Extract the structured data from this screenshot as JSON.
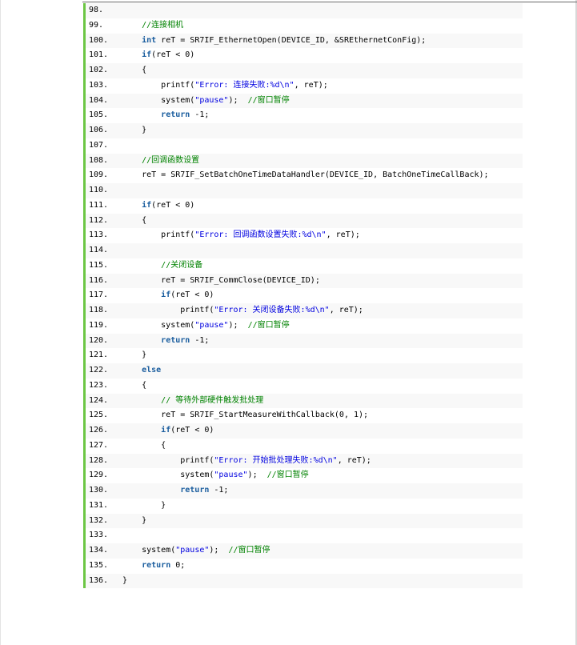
{
  "lines": [
    {
      "num": "98.",
      "parts": []
    },
    {
      "num": "99.",
      "parts": [
        [
          "",
          "    "
        ],
        [
          "cm",
          "//连接相机"
        ]
      ]
    },
    {
      "num": "100.",
      "parts": [
        [
          "",
          "    "
        ],
        [
          "kw",
          "int"
        ],
        [
          "",
          " reT = SR7IF_EthernetOpen(DEVICE_ID, &SREthernetConFig);"
        ]
      ]
    },
    {
      "num": "101.",
      "parts": [
        [
          "",
          "    "
        ],
        [
          "kw",
          "if"
        ],
        [
          "",
          "(reT < 0)"
        ]
      ]
    },
    {
      "num": "102.",
      "parts": [
        [
          "",
          "    {"
        ]
      ]
    },
    {
      "num": "103.",
      "parts": [
        [
          "",
          "        printf("
        ],
        [
          "str",
          "\"Error: 连接失败:%d\\n\""
        ],
        [
          "",
          ", reT);"
        ]
      ]
    },
    {
      "num": "104.",
      "parts": [
        [
          "",
          "        system("
        ],
        [
          "str",
          "\"pause\""
        ],
        [
          "",
          ");  "
        ],
        [
          "cm",
          "//窗口暂停"
        ]
      ]
    },
    {
      "num": "105.",
      "parts": [
        [
          "",
          "        "
        ],
        [
          "kw",
          "return"
        ],
        [
          "",
          " -1;"
        ]
      ]
    },
    {
      "num": "106.",
      "parts": [
        [
          "",
          "    }"
        ]
      ]
    },
    {
      "num": "107.",
      "parts": []
    },
    {
      "num": "108.",
      "parts": [
        [
          "",
          "    "
        ],
        [
          "cm",
          "//回调函数设置"
        ]
      ]
    },
    {
      "num": "109.",
      "parts": [
        [
          "",
          "    reT = SR7IF_SetBatchOneTimeDataHandler(DEVICE_ID, BatchOneTimeCallBack);"
        ]
      ]
    },
    {
      "num": "110.",
      "parts": []
    },
    {
      "num": "111.",
      "parts": [
        [
          "",
          "    "
        ],
        [
          "kw",
          "if"
        ],
        [
          "",
          "(reT < 0)"
        ]
      ]
    },
    {
      "num": "112.",
      "parts": [
        [
          "",
          "    {"
        ]
      ]
    },
    {
      "num": "113.",
      "parts": [
        [
          "",
          "        printf("
        ],
        [
          "str",
          "\"Error: 回调函数设置失败:%d\\n\""
        ],
        [
          "",
          ", reT);"
        ]
      ]
    },
    {
      "num": "114.",
      "parts": []
    },
    {
      "num": "115.",
      "parts": [
        [
          "",
          "        "
        ],
        [
          "cm",
          "//关闭设备"
        ]
      ]
    },
    {
      "num": "116.",
      "parts": [
        [
          "",
          "        reT = SR7IF_CommClose(DEVICE_ID);"
        ]
      ]
    },
    {
      "num": "117.",
      "parts": [
        [
          "",
          "        "
        ],
        [
          "kw",
          "if"
        ],
        [
          "",
          "(reT < 0)"
        ]
      ]
    },
    {
      "num": "118.",
      "parts": [
        [
          "",
          "            printf("
        ],
        [
          "str",
          "\"Error: 关闭设备失败:%d\\n\""
        ],
        [
          "",
          ", reT);"
        ]
      ]
    },
    {
      "num": "119.",
      "parts": [
        [
          "",
          "        system("
        ],
        [
          "str",
          "\"pause\""
        ],
        [
          "",
          ");  "
        ],
        [
          "cm",
          "//窗口暂停"
        ]
      ]
    },
    {
      "num": "120.",
      "parts": [
        [
          "",
          "        "
        ],
        [
          "kw",
          "return"
        ],
        [
          "",
          " -1;"
        ]
      ]
    },
    {
      "num": "121.",
      "parts": [
        [
          "",
          "    }"
        ]
      ]
    },
    {
      "num": "122.",
      "parts": [
        [
          "",
          "    "
        ],
        [
          "kw",
          "else"
        ]
      ]
    },
    {
      "num": "123.",
      "parts": [
        [
          "",
          "    {"
        ]
      ]
    },
    {
      "num": "124.",
      "parts": [
        [
          "",
          "        "
        ],
        [
          "cm",
          "// 等待外部硬件触发批处理"
        ]
      ]
    },
    {
      "num": "125.",
      "parts": [
        [
          "",
          "        reT = SR7IF_StartMeasureWithCallback(0, 1);"
        ]
      ]
    },
    {
      "num": "126.",
      "parts": [
        [
          "",
          "        "
        ],
        [
          "kw",
          "if"
        ],
        [
          "",
          "(reT < 0)"
        ]
      ]
    },
    {
      "num": "127.",
      "parts": [
        [
          "",
          "        {"
        ]
      ]
    },
    {
      "num": "128.",
      "parts": [
        [
          "",
          "            printf("
        ],
        [
          "str",
          "\"Error: 开始批处理失败:%d\\n\""
        ],
        [
          "",
          ", reT);"
        ]
      ]
    },
    {
      "num": "129.",
      "parts": [
        [
          "",
          "            system("
        ],
        [
          "str",
          "\"pause\""
        ],
        [
          "",
          ");  "
        ],
        [
          "cm",
          "//窗口暂停"
        ]
      ]
    },
    {
      "num": "130.",
      "parts": [
        [
          "",
          "            "
        ],
        [
          "kw",
          "return"
        ],
        [
          "",
          " -1;"
        ]
      ]
    },
    {
      "num": "131.",
      "parts": [
        [
          "",
          "        }"
        ]
      ]
    },
    {
      "num": "132.",
      "parts": [
        [
          "",
          "    }"
        ]
      ]
    },
    {
      "num": "133.",
      "parts": []
    },
    {
      "num": "134.",
      "parts": [
        [
          "",
          "    system("
        ],
        [
          "str",
          "\"pause\""
        ],
        [
          "",
          ");  "
        ],
        [
          "cm",
          "//窗口暂停"
        ]
      ]
    },
    {
      "num": "135.",
      "parts": [
        [
          "",
          "    "
        ],
        [
          "kw",
          "return"
        ],
        [
          "",
          " 0;"
        ]
      ]
    },
    {
      "num": "136.",
      "parts": [
        [
          "",
          "}"
        ]
      ]
    }
  ],
  "colors": {
    "gutter_bar": "#6cc644",
    "keyword": "#1a5d9e",
    "string": "#0000e0",
    "comment": "#008200",
    "row_alt": "#f8f8f8"
  }
}
